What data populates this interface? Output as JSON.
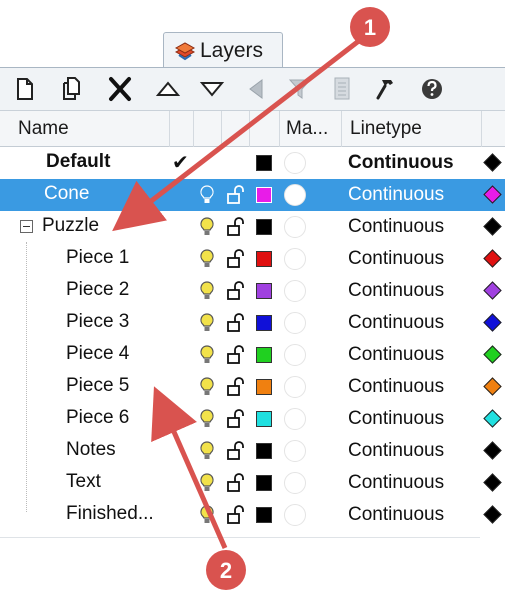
{
  "tab": {
    "label": "Layers",
    "icon": "layers-icon"
  },
  "toolbar": {
    "buttons": [
      {
        "name": "new-layer-button",
        "icon": "new-document-icon"
      },
      {
        "name": "new-sublayer-button",
        "icon": "copy-document-icon"
      },
      {
        "name": "delete-layer-button",
        "icon": "delete-x-icon"
      },
      {
        "name": "move-up-button",
        "icon": "triangle-up-icon"
      },
      {
        "name": "move-down-button",
        "icon": "triangle-down-icon"
      },
      {
        "name": "move-out-button",
        "icon": "triangle-left-icon"
      },
      {
        "name": "filter-button",
        "icon": "funnel-icon"
      },
      {
        "name": "layer-states-button",
        "icon": "document-grid-icon"
      },
      {
        "name": "tools-button",
        "icon": "hammer-icon"
      },
      {
        "name": "help-button",
        "icon": "help-icon"
      }
    ]
  },
  "columns": {
    "name": "Name",
    "material": "Ma...",
    "linetype": "Linetype"
  },
  "layers": [
    {
      "name": "Default",
      "bold": true,
      "current": true,
      "check": "✔",
      "color": "#000000",
      "linetype": "Continuous",
      "indent": 0
    },
    {
      "name": "Cone",
      "selected": true,
      "color": "#e81ce8",
      "linetype": "Continuous",
      "indent": 0
    },
    {
      "name": "Puzzle",
      "expander": true,
      "color": "#000000",
      "linetype": "Continuous",
      "indent": 0
    },
    {
      "name": "Piece 1",
      "color": "#e01010",
      "linetype": "Continuous",
      "indent": 1
    },
    {
      "name": "Piece 2",
      "color": "#a040e0",
      "linetype": "Continuous",
      "indent": 1
    },
    {
      "name": "Piece 3",
      "color": "#1010d8",
      "linetype": "Continuous",
      "indent": 1
    },
    {
      "name": "Piece 4",
      "color": "#20d020",
      "linetype": "Continuous",
      "indent": 1
    },
    {
      "name": "Piece 5",
      "color": "#f08010",
      "linetype": "Continuous",
      "indent": 1
    },
    {
      "name": "Piece 6",
      "color": "#20e0e0",
      "linetype": "Continuous",
      "indent": 1
    },
    {
      "name": "Notes",
      "color": "#000000",
      "linetype": "Continuous",
      "indent": 1
    },
    {
      "name": "Text",
      "color": "#000000",
      "linetype": "Continuous",
      "indent": 1
    },
    {
      "name": "Finished...",
      "color": "#000000",
      "linetype": "Continuous",
      "indent": 1
    }
  ],
  "callouts": [
    {
      "label": "1",
      "color": "#d9534f"
    },
    {
      "label": "2",
      "color": "#d9534f"
    }
  ],
  "colors": {
    "selection": "#3a9ae2",
    "bulb": "#f2e24a",
    "callout": "#d9534f"
  }
}
